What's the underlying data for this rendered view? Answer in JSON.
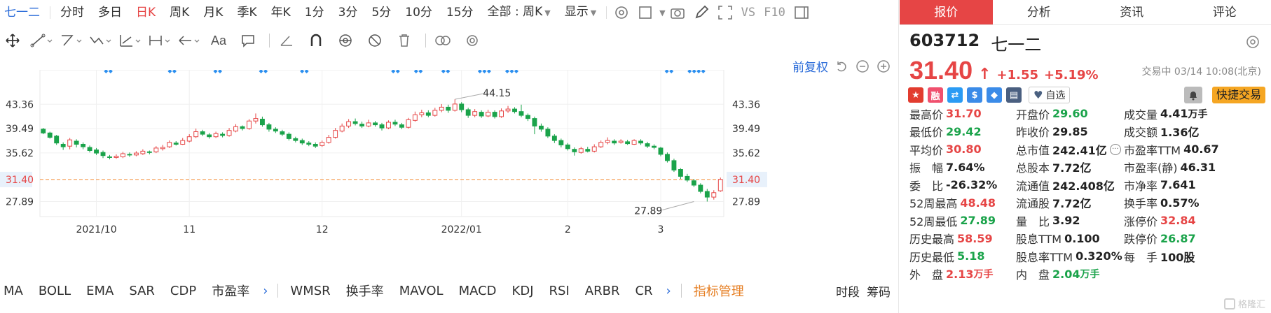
{
  "periods": [
    "七一二",
    "分时",
    "多日",
    "日K",
    "周K",
    "月K",
    "季K",
    "年K",
    "1分",
    "3分",
    "5分",
    "10分",
    "15分"
  ],
  "active_period": "日K",
  "range_select": "全部 : 周K",
  "display_select": "显示",
  "vs_label": "VS",
  "f10_label": "F10",
  "adjust_label": "前复权",
  "tabs": [
    "报价",
    "分析",
    "资讯",
    "评论"
  ],
  "active_tab": "报价",
  "stock": {
    "code": "603712",
    "name": "七一二",
    "price": "31.40",
    "change": "+1.55",
    "change_pct": "+5.19%",
    "trade_status": "交易中 03/14 10:08(北京)",
    "watch_label": "自选",
    "fast_trade_label": "快捷交易"
  },
  "badges": [
    {
      "name": "cn-flag-icon",
      "color": "#e23c2f",
      "glyph": "★"
    },
    {
      "name": "margin-icon",
      "color": "#f0506e",
      "glyph": "融"
    },
    {
      "name": "connect-icon",
      "color": "#2b9bf4",
      "glyph": "⇄"
    },
    {
      "name": "dollar-icon",
      "color": "#3b8be8",
      "glyph": "$"
    },
    {
      "name": "tag-icon",
      "color": "#3b8be8",
      "glyph": "◆"
    },
    {
      "name": "report-icon",
      "color": "#4a5f80",
      "glyph": "▤"
    }
  ],
  "stats": [
    [
      {
        "label": "最高价",
        "value": "31.70",
        "color": "red"
      },
      {
        "label": "开盘价",
        "value": "29.60",
        "color": "green"
      },
      {
        "label": "成交量",
        "value": "4.41",
        "unit": "万手",
        "color": ""
      }
    ],
    [
      {
        "label": "最低价",
        "value": "29.42",
        "color": "green"
      },
      {
        "label": "昨收价",
        "value": "29.85",
        "color": ""
      },
      {
        "label": "成交额",
        "value": "1.36亿",
        "color": ""
      }
    ],
    [
      {
        "label": "平均价",
        "value": "30.80",
        "color": "red"
      },
      {
        "label": "总市值",
        "value": "242.41亿",
        "color": "",
        "info": true
      },
      {
        "label": "市盈率TTM",
        "value": "40.67",
        "color": ""
      }
    ],
    [
      {
        "label": "振　幅",
        "value": "7.64%",
        "color": ""
      },
      {
        "label": "总股本",
        "value": "7.72亿",
        "color": ""
      },
      {
        "label": "市盈率(静)",
        "value": "46.31",
        "color": ""
      }
    ],
    [
      {
        "label": "委　比",
        "value": "-26.32%",
        "color": ""
      },
      {
        "label": "流通值",
        "value": "242.408亿",
        "color": ""
      },
      {
        "label": "市净率",
        "value": "7.641",
        "color": ""
      }
    ],
    [
      {
        "label": "52周最高",
        "value": "48.48",
        "color": "red"
      },
      {
        "label": "流通股",
        "value": "7.72亿",
        "color": ""
      },
      {
        "label": "换手率",
        "value": "0.57%",
        "color": ""
      }
    ],
    [
      {
        "label": "52周最低",
        "value": "27.89",
        "color": "green"
      },
      {
        "label": "量　比",
        "value": "3.92",
        "color": ""
      },
      {
        "label": "涨停价",
        "value": "32.84",
        "color": "red"
      }
    ],
    [
      {
        "label": "历史最高",
        "value": "58.59",
        "color": "red"
      },
      {
        "label": "股息TTM",
        "value": "0.100",
        "color": ""
      },
      {
        "label": "跌停价",
        "value": "26.87",
        "color": "green"
      }
    ],
    [
      {
        "label": "历史最低",
        "value": "5.18",
        "color": "green"
      },
      {
        "label": "股息率TTM",
        "value": "0.320%",
        "color": ""
      },
      {
        "label": "每　手",
        "value": "100股",
        "color": ""
      }
    ],
    [
      {
        "label": "外　盘",
        "value": "2.13",
        "unit": "万手",
        "color": "red"
      },
      {
        "label": "内　盘",
        "value": "2.04",
        "unit": "万手",
        "color": "green"
      },
      {
        "label": "",
        "value": "",
        "color": ""
      }
    ]
  ],
  "indicators": [
    "MA",
    "BOLL",
    "EMA",
    "SAR",
    "CDP",
    "市盈率"
  ],
  "indicators2": [
    "WMSR",
    "换手率",
    "MAVOL",
    "MACD",
    "KDJ",
    "RSI",
    "ARBR",
    "CR"
  ],
  "indicator_manage": "指标管理",
  "bottom_right": [
    "时段",
    "筹码"
  ],
  "watermark": "格隆汇",
  "colors": {
    "up": "#e64545",
    "down": "#1aa34a",
    "accent": "#2b6cd9",
    "marker": "#2b8ff0",
    "last_line": "#f5a05a"
  },
  "chart_data": {
    "type": "candlestick",
    "y_ticks": [
      "43.36",
      "39.49",
      "35.62",
      "31.40",
      "27.89"
    ],
    "y_tick_values": [
      43.36,
      39.49,
      35.62,
      31.4,
      27.89
    ],
    "ylim": [
      25.5,
      45.5
    ],
    "x_labels": [
      {
        "label": "2021/10",
        "i": 8
      },
      {
        "label": "11",
        "i": 22
      },
      {
        "label": "12",
        "i": 42
      },
      {
        "label": "2022/01",
        "i": 63
      },
      {
        "label": "2",
        "i": 79
      },
      {
        "label": "3",
        "i": 93
      }
    ],
    "last_price": 31.4,
    "annotations": [
      {
        "label": "44.15",
        "i": 62,
        "value": 44.15
      },
      {
        "label": "27.89",
        "i": 98,
        "value": 27.89
      }
    ],
    "candles": [
      [
        39.4,
        38.8,
        39.6,
        38.6
      ],
      [
        38.8,
        38.1,
        39.0,
        37.9
      ],
      [
        38.3,
        37.2,
        38.5,
        36.9
      ],
      [
        37.0,
        36.6,
        37.3,
        36.1
      ],
      [
        36.7,
        37.7,
        38.0,
        36.2
      ],
      [
        37.5,
        37.0,
        37.8,
        36.5
      ],
      [
        37.0,
        36.6,
        37.3,
        36.2
      ],
      [
        36.5,
        36.0,
        36.8,
        35.7
      ],
      [
        36.1,
        35.6,
        36.4,
        35.3
      ],
      [
        35.7,
        35.2,
        36.0,
        34.8
      ],
      [
        35.0,
        34.9,
        35.3,
        34.6
      ],
      [
        34.9,
        35.1,
        35.4,
        34.7
      ],
      [
        35.0,
        35.5,
        35.8,
        34.8
      ],
      [
        35.4,
        35.3,
        35.7,
        35.0
      ],
      [
        35.3,
        35.6,
        35.9,
        35.1
      ],
      [
        35.5,
        35.9,
        36.2,
        35.3
      ],
      [
        35.8,
        35.7,
        36.0,
        35.4
      ],
      [
        35.8,
        36.4,
        36.7,
        35.6
      ],
      [
        36.3,
        36.5,
        36.9,
        36.0
      ],
      [
        36.6,
        37.3,
        37.6,
        36.4
      ],
      [
        37.2,
        37.0,
        37.5,
        36.8
      ],
      [
        37.0,
        37.6,
        38.0,
        36.9
      ],
      [
        37.5,
        38.2,
        38.6,
        37.3
      ],
      [
        38.2,
        39.0,
        39.5,
        38.0
      ],
      [
        39.0,
        38.6,
        39.3,
        38.3
      ],
      [
        38.5,
        38.2,
        38.8,
        37.9
      ],
      [
        38.2,
        38.7,
        39.0,
        38.0
      ],
      [
        38.6,
        38.4,
        38.9,
        38.1
      ],
      [
        38.4,
        39.2,
        39.6,
        38.2
      ],
      [
        39.1,
        39.8,
        40.2,
        38.9
      ],
      [
        39.8,
        39.5,
        40.0,
        39.2
      ],
      [
        39.5,
        40.7,
        41.0,
        39.3
      ],
      [
        40.7,
        41.1,
        41.9,
        40.3
      ],
      [
        41.0,
        40.1,
        41.4,
        39.8
      ],
      [
        40.1,
        39.4,
        40.4,
        39.0
      ],
      [
        39.4,
        39.1,
        39.7,
        38.8
      ],
      [
        39.0,
        38.6,
        39.3,
        38.3
      ],
      [
        38.6,
        37.9,
        38.9,
        37.6
      ],
      [
        37.9,
        37.6,
        38.2,
        37.3
      ],
      [
        37.6,
        37.2,
        37.9,
        36.9
      ],
      [
        37.2,
        37.0,
        37.5,
        36.7
      ],
      [
        37.0,
        36.7,
        37.3,
        36.4
      ],
      [
        36.8,
        37.3,
        37.6,
        36.6
      ],
      [
        37.3,
        38.1,
        38.5,
        37.1
      ],
      [
        38.1,
        39.2,
        39.6,
        37.9
      ],
      [
        39.1,
        39.9,
        40.3,
        38.9
      ],
      [
        39.9,
        40.6,
        41.0,
        39.6
      ],
      [
        40.6,
        40.3,
        41.1,
        40.0
      ],
      [
        40.2,
        39.9,
        40.6,
        39.6
      ],
      [
        39.9,
        40.4,
        40.9,
        39.7
      ],
      [
        40.4,
        40.1,
        40.7,
        39.8
      ],
      [
        40.1,
        39.6,
        40.4,
        39.2
      ],
      [
        39.6,
        40.5,
        40.8,
        39.4
      ],
      [
        40.5,
        40.2,
        40.9,
        39.9
      ],
      [
        40.1,
        39.7,
        40.4,
        39.4
      ],
      [
        39.7,
        40.9,
        41.2,
        39.5
      ],
      [
        40.8,
        41.7,
        42.2,
        40.6
      ],
      [
        41.7,
        42.0,
        42.5,
        41.3
      ],
      [
        42.0,
        41.6,
        42.4,
        41.3
      ],
      [
        41.6,
        42.4,
        42.8,
        41.4
      ],
      [
        42.4,
        42.9,
        43.4,
        42.1
      ],
      [
        42.9,
        42.4,
        43.3,
        42.0
      ],
      [
        42.4,
        43.4,
        44.15,
        42.2
      ],
      [
        43.4,
        42.5,
        43.7,
        42.1
      ],
      [
        42.5,
        41.6,
        42.8,
        41.2
      ],
      [
        41.6,
        42.2,
        42.6,
        41.3
      ],
      [
        42.1,
        41.5,
        42.4,
        41.2
      ],
      [
        41.5,
        42.1,
        42.5,
        41.3
      ],
      [
        42.1,
        41.4,
        42.4,
        41.1
      ],
      [
        41.4,
        42.3,
        42.7,
        41.2
      ],
      [
        42.3,
        42.6,
        43.1,
        42.0
      ],
      [
        42.6,
        42.2,
        42.9,
        41.9
      ],
      [
        42.2,
        41.6,
        43.3,
        41.3
      ],
      [
        41.6,
        41.1,
        41.9,
        40.7
      ],
      [
        41.1,
        39.9,
        41.4,
        38.6
      ],
      [
        39.9,
        39.4,
        40.3,
        39.0
      ],
      [
        39.4,
        38.3,
        39.7,
        38.0
      ],
      [
        38.3,
        37.6,
        38.6,
        37.2
      ],
      [
        37.6,
        36.9,
        37.9,
        36.5
      ],
      [
        36.9,
        36.3,
        37.2,
        36.0
      ],
      [
        36.2,
        35.8,
        36.5,
        35.2
      ],
      [
        35.7,
        36.3,
        36.6,
        35.5
      ],
      [
        36.2,
        35.9,
        36.6,
        35.7
      ],
      [
        35.9,
        36.6,
        37.0,
        35.7
      ],
      [
        36.6,
        37.3,
        37.6,
        36.4
      ],
      [
        37.3,
        37.6,
        38.1,
        37.0
      ],
      [
        37.5,
        37.2,
        37.8,
        36.9
      ],
      [
        37.3,
        37.5,
        37.8,
        37.1
      ],
      [
        37.4,
        37.1,
        37.7,
        36.9
      ],
      [
        37.0,
        37.6,
        37.8,
        36.9
      ],
      [
        37.5,
        37.2,
        37.8,
        36.9
      ],
      [
        37.1,
        36.7,
        37.4,
        36.4
      ],
      [
        36.7,
        36.5,
        37.0,
        36.2
      ],
      [
        36.4,
        35.4,
        36.6,
        35.1
      ],
      [
        35.4,
        34.4,
        35.7,
        34.1
      ],
      [
        34.4,
        32.9,
        34.7,
        32.6
      ],
      [
        33.0,
        31.9,
        33.2,
        31.5
      ],
      [
        31.9,
        31.3,
        32.3,
        31.0
      ],
      [
        31.2,
        30.5,
        31.5,
        30.2
      ],
      [
        30.5,
        29.5,
        30.8,
        29.2
      ],
      [
        29.5,
        28.6,
        29.9,
        27.89
      ],
      [
        28.6,
        29.3,
        29.7,
        28.2
      ],
      [
        29.6,
        31.4,
        31.7,
        29.42
      ]
    ],
    "markers": [
      14,
      15,
      28,
      29,
      38,
      39,
      48,
      49,
      57,
      58,
      77,
      78,
      82,
      83,
      88,
      89,
      96,
      97,
      98,
      102,
      103,
      104,
      137,
      138,
      142,
      143,
      144,
      145
    ]
  }
}
